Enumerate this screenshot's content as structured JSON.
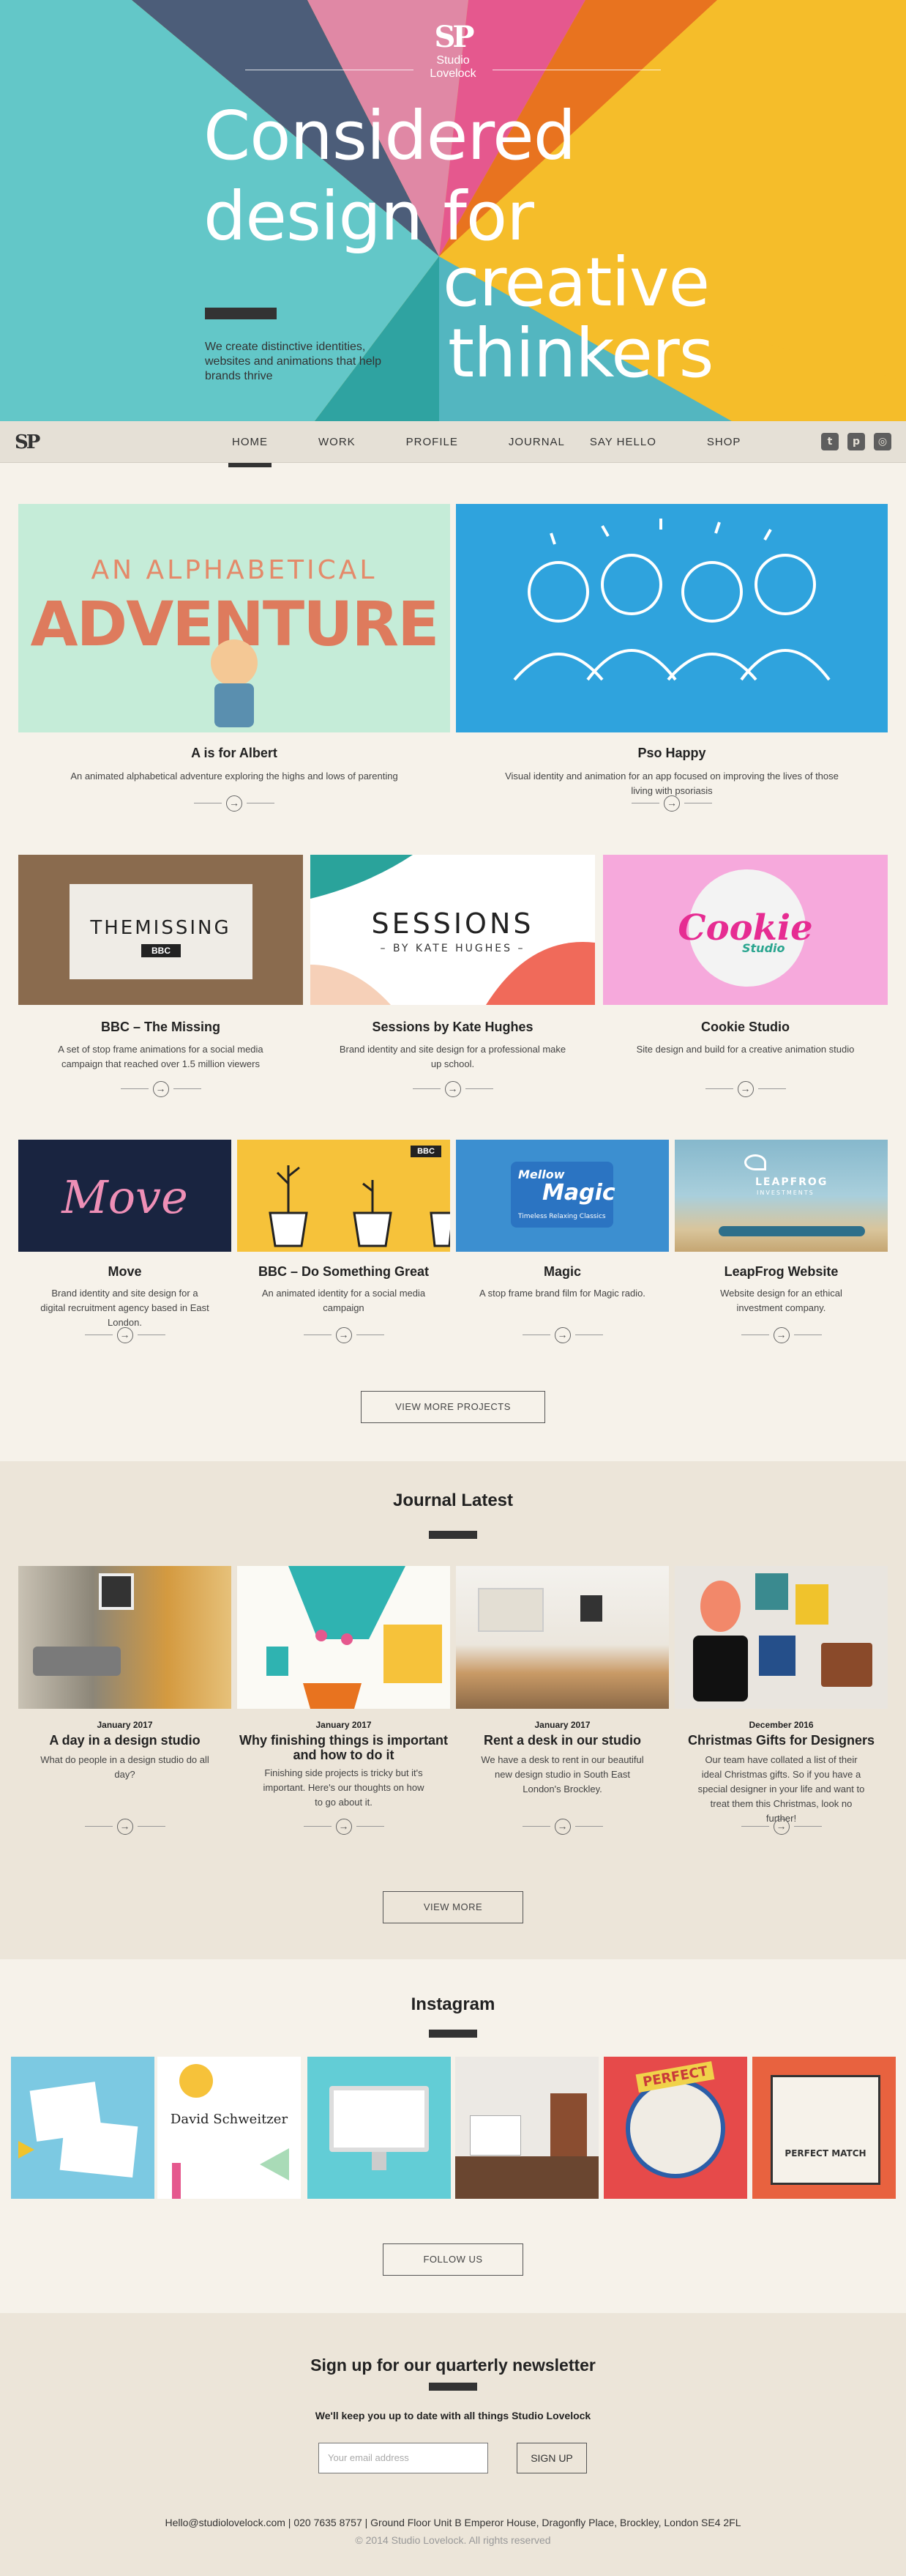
{
  "hero": {
    "logo_mark": "SP",
    "logo_name": "Studio Lovelock",
    "headline": [
      "Considered",
      "design for",
      "creative",
      "thinkers"
    ],
    "subtext": "We create distinctive identities, websites and animations that help brands thrive"
  },
  "nav": {
    "logo": "SP",
    "items": [
      "HOME",
      "WORK",
      "PROFILE",
      "JOURNAL",
      "SAY HELLO",
      "SHOP"
    ],
    "active": "HOME",
    "social": [
      "twitter-icon",
      "pinterest-icon",
      "instagram-icon"
    ]
  },
  "projects": [
    {
      "title": "A is for Albert",
      "desc": "An animated alphabetical adventure exploring the highs and lows of parenting",
      "art": [
        "AN ALPHABETICAL",
        "ADVENTURE"
      ]
    },
    {
      "title": "Pso Happy",
      "desc": "Visual identity and animation for an app focused on improving the lives of those living with psoriasis"
    },
    {
      "title": "BBC – The Missing",
      "desc": "A set of stop frame animations for a social media campaign that reached over 1.5 million viewers",
      "art": [
        "THEMISSING",
        "BBC"
      ]
    },
    {
      "title": "Sessions by Kate Hughes",
      "desc": "Brand identity and site design for a professional make up school.",
      "art": [
        "SESSIONS",
        "– BY KATE HUGHES –"
      ]
    },
    {
      "title": "Cookie Studio",
      "desc": "Site design and build for a creative animation studio",
      "art": [
        "Cookie",
        "Studio"
      ]
    },
    {
      "title": "Move",
      "desc": "Brand identity and site design for a digital recruitment agency based in East London.",
      "art": [
        "Move"
      ]
    },
    {
      "title": "BBC – Do Something Great",
      "desc": "An animated identity for a social media campaign",
      "art": [
        "BBC"
      ]
    },
    {
      "title": "Magic",
      "desc": "A stop frame brand film for Magic radio.",
      "art": [
        "Mellow",
        "Magic",
        "Timeless Relaxing Classics"
      ]
    },
    {
      "title": "LeapFrog Website",
      "desc": "Website design for an ethical investment company.",
      "art": [
        "LEAPFROG",
        "INVESTMENTS"
      ]
    }
  ],
  "view_more_projects": "VIEW MORE PROJECTS",
  "journal": {
    "title": "Journal Latest",
    "posts": [
      {
        "date": "January 2017",
        "title": "A day in a design studio",
        "desc": "What do people in a design studio do all day?"
      },
      {
        "date": "January 2017",
        "title": "Why finishing things is important and how to do it",
        "desc": "Finishing side projects is tricky but it's important. Here's our thoughts on how to go about it."
      },
      {
        "date": "January 2017",
        "title": "Rent a desk in our studio",
        "desc": "We have a desk to rent in our beautiful new design studio in South East London's Brockley."
      },
      {
        "date": "December 2016",
        "title": "Christmas Gifts for Designers",
        "desc": "Our team have collated a list of their ideal Christmas gifts. So if you have a special designer in your life and want to treat them this Christmas, look no further!"
      }
    ],
    "view_more": "VIEW MORE"
  },
  "instagram": {
    "title": "Instagram",
    "images": [
      "insta-illustration",
      "David Schweitzer",
      "insta-imac",
      "insta-desk",
      "PERFECT",
      "PERFECT MATCH"
    ],
    "follow": "FOLLOW US"
  },
  "newsletter": {
    "title": "Sign up for our quarterly newsletter",
    "sub": "We'll keep you up to date with all things Studio Lovelock",
    "placeholder": "Your email address",
    "button": "SIGN UP",
    "contact": "Hello@studiolovelock.com | 020 7635 8757 | Ground Floor Unit B Emperor House, Dragonfly Place, Brockley, London SE4 2FL",
    "copyright": "© 2014 Studio Lovelock. All rights reserved"
  }
}
